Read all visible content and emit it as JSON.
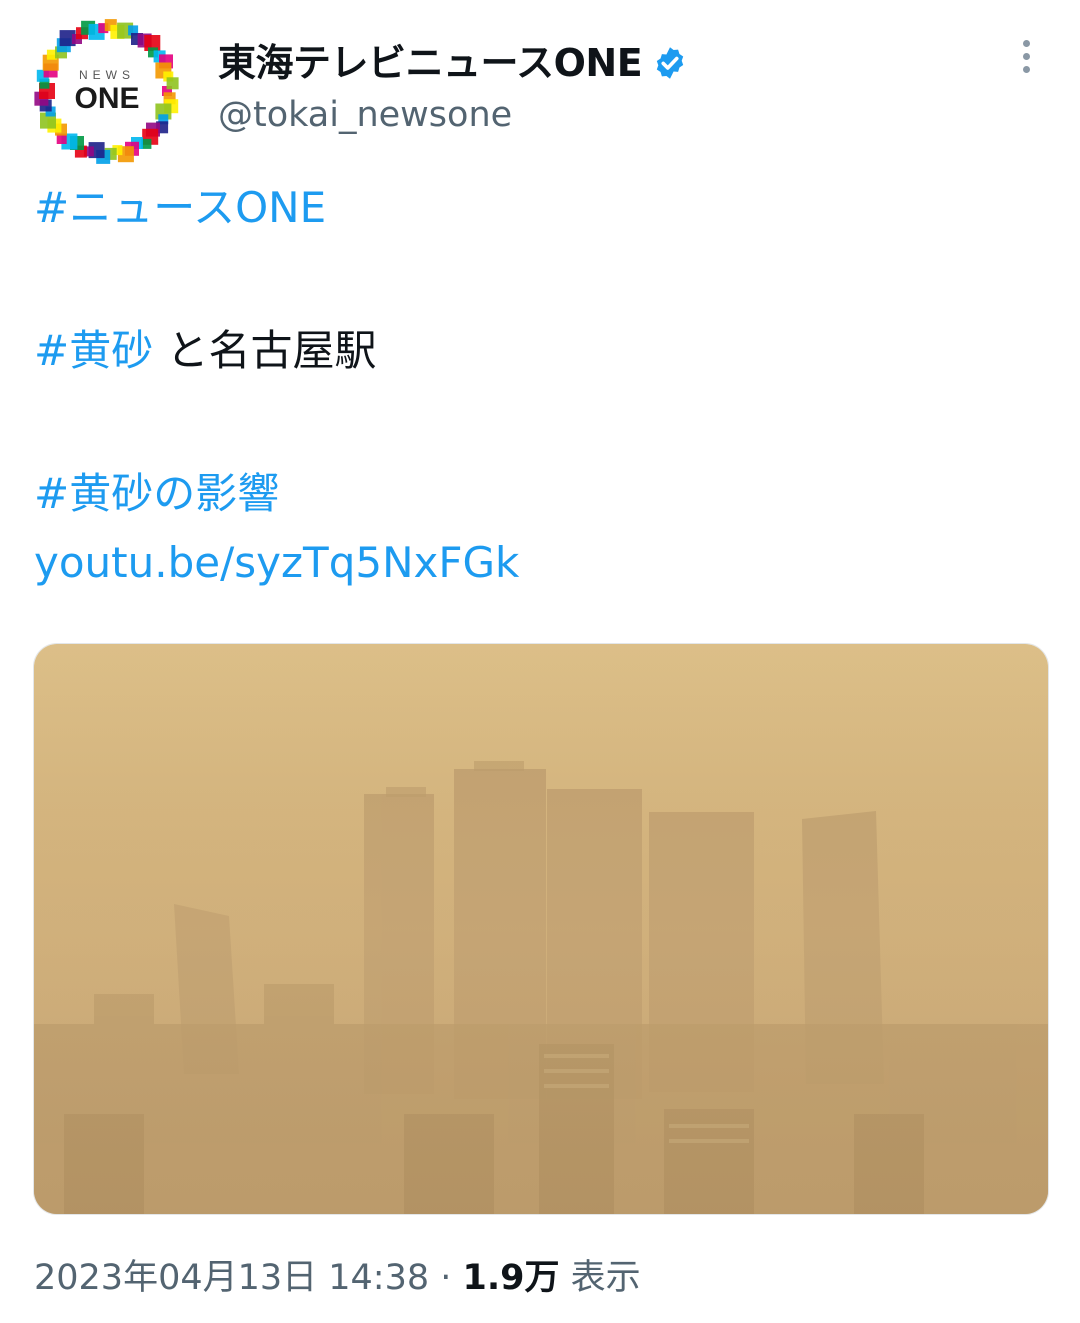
{
  "account": {
    "name": "東海テレビニュースONE",
    "handle": "@tokai_newsone",
    "verified": true,
    "avatar_text_small": "NEWS",
    "avatar_text_large": "ONE"
  },
  "tweet": {
    "hashtag_1": "#ニュースONE",
    "hashtag_2": "#黄砂",
    "text_2": " と名古屋駅",
    "hashtag_3": "#黄砂の影響",
    "link": "youtu.be/syzTq5NxFGk"
  },
  "media": {
    "description_icon": "photo-image"
  },
  "meta": {
    "timestamp": "2023年04月13日 14:38",
    "separator": " · ",
    "views_count": "1.9万",
    "views_label": " 表示"
  },
  "colors": {
    "link": "#1d9bf0",
    "verified_badge": "#1d9bf0",
    "secondary_text": "#536471",
    "haze": "#c9a671"
  },
  "icons": {
    "more": "more-dots-vertical-icon",
    "verified": "verified-badge-icon"
  }
}
